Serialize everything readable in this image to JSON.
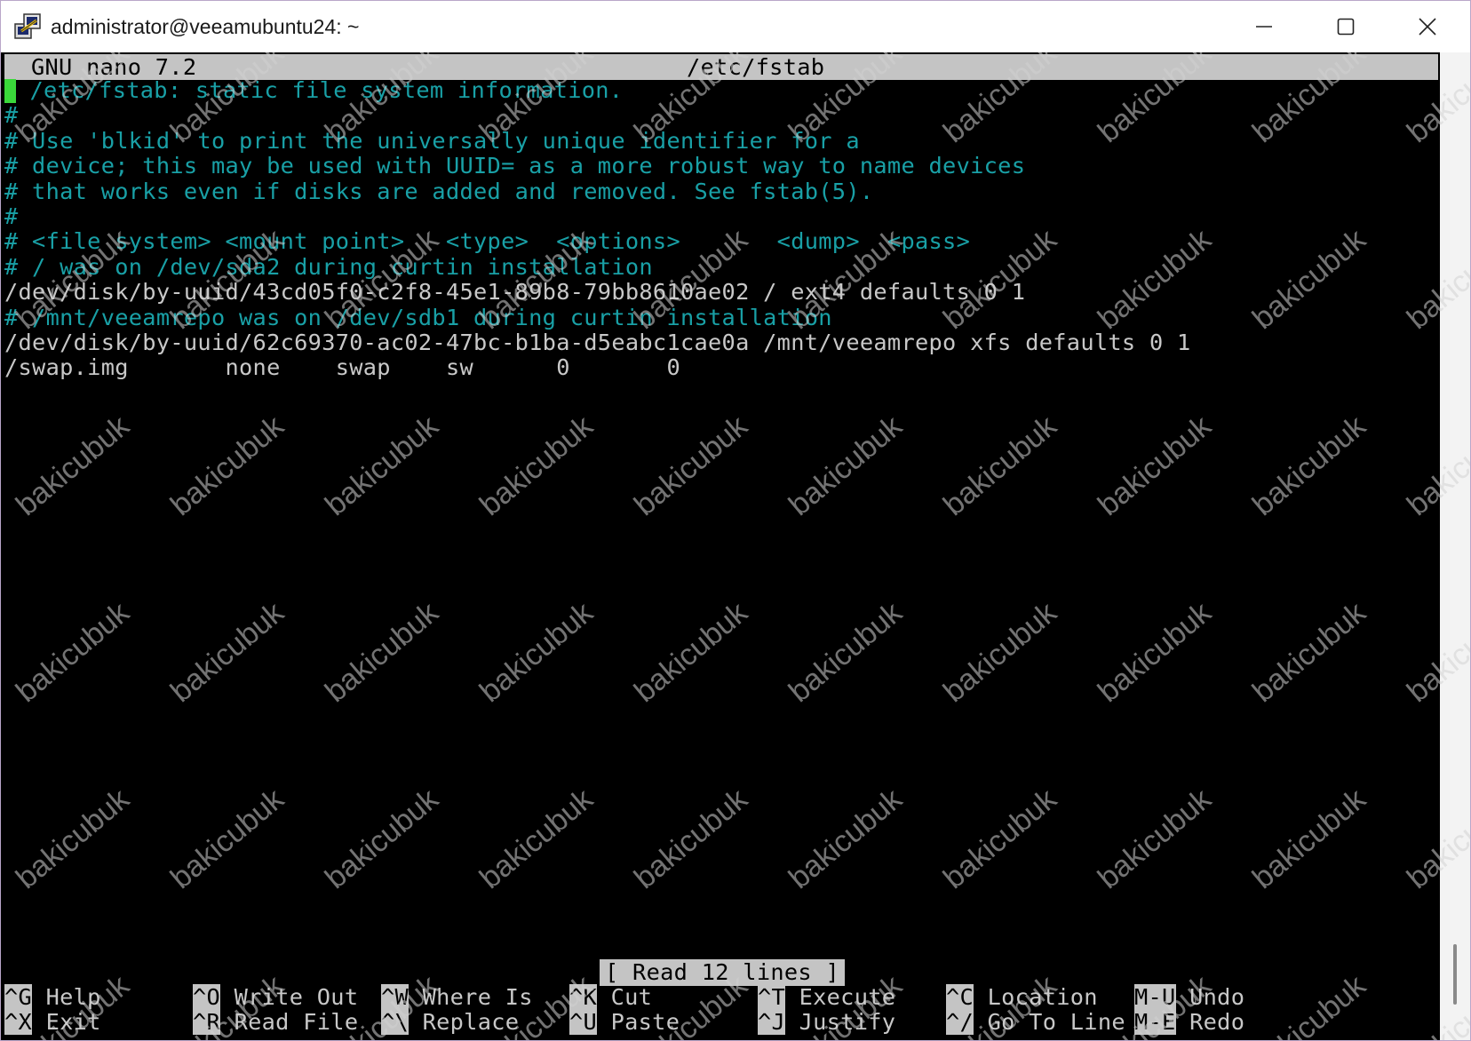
{
  "window": {
    "title": "administrator@veeamubuntu24: ~"
  },
  "nano": {
    "version_label": "GNU nano 7.2",
    "filename": "/etc/fstab",
    "lines": [
      {
        "text": " /etc/fstab: static file system information.",
        "type": "comment",
        "cursor_first": true
      },
      {
        "text": "#",
        "type": "comment"
      },
      {
        "text": "# Use 'blkid' to print the universally unique identifier for a",
        "type": "comment"
      },
      {
        "text": "# device; this may be used with UUID= as a more robust way to name devices",
        "type": "comment"
      },
      {
        "text": "# that works even if disks are added and removed. See fstab(5).",
        "type": "comment"
      },
      {
        "text": "#",
        "type": "comment"
      },
      {
        "text": "# <file system> <mount point>   <type>  <options>       <dump>  <pass>",
        "type": "comment"
      },
      {
        "text": "# / was on /dev/sda2 during curtin installation",
        "type": "comment"
      },
      {
        "text": "/dev/disk/by-uuid/43cd05f0-c2f8-45e1-89b8-79bb8610ae02 / ext4 defaults 0 1",
        "type": "entry"
      },
      {
        "text": "# /mnt/veeamrepo was on /dev/sdb1 during curtin installation",
        "type": "comment"
      },
      {
        "text": "/dev/disk/by-uuid/62c69370-ac02-47bc-b1ba-d5eabc1cae0a /mnt/veeamrepo xfs defaults 0 1",
        "type": "entry"
      },
      {
        "text": "/swap.img       none    swap    sw      0       0",
        "type": "entry"
      }
    ],
    "status_message": "[ Read 12 lines ]",
    "shortcuts_row1": [
      {
        "key": "^G",
        "label": "Help"
      },
      {
        "key": "^O",
        "label": "Write Out"
      },
      {
        "key": "^W",
        "label": "Where Is"
      },
      {
        "key": "^K",
        "label": "Cut"
      },
      {
        "key": "^T",
        "label": "Execute"
      },
      {
        "key": "^C",
        "label": "Location"
      },
      {
        "key": "M-U",
        "label": "Undo"
      }
    ],
    "shortcuts_row2": [
      {
        "key": "^X",
        "label": "Exit"
      },
      {
        "key": "^R",
        "label": "Read File"
      },
      {
        "key": "^\\",
        "label": "Replace"
      },
      {
        "key": "^U",
        "label": "Paste"
      },
      {
        "key": "^J",
        "label": "Justify"
      },
      {
        "key": "^/",
        "label": "Go To Line"
      },
      {
        "key": "M-E",
        "label": "Redo"
      }
    ]
  },
  "watermark": {
    "text": "bakicubuk"
  },
  "colors": {
    "terminal_bg": "#000000",
    "comment": "#19a0a6",
    "text": "#c8c8c8",
    "header_bg": "#c4c4c4",
    "cursor": "#3ad83a"
  }
}
